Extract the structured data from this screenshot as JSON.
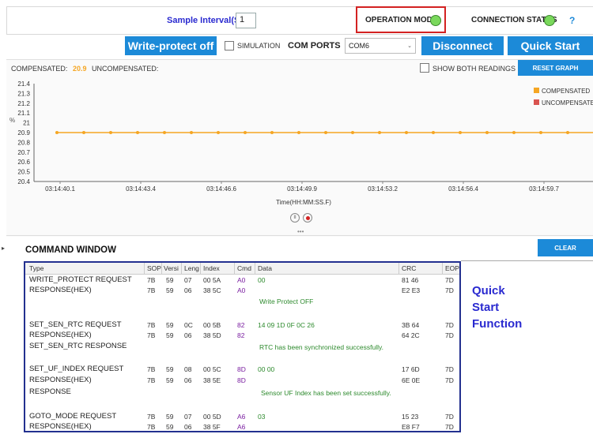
{
  "header": {
    "sample_interval_label": "Sample Interval(S)",
    "sample_interval_value": "1",
    "operation_mode_label": "OPERATION MODE",
    "connection_status_label": "CONNECTION STATUS",
    "help_label": "?"
  },
  "toolbar": {
    "write_protect_label": "Write-protect off",
    "simulation_label": "SIMULATION",
    "com_ports_label": "COM PORTS",
    "com_port_value": "COM6",
    "disconnect_label": "Disconnect",
    "quick_start_label": "Quick Start"
  },
  "readings": {
    "compensated_label": "COMPENSATED:",
    "compensated_value": "20.9",
    "uncompensated_label": "UNCOMPENSATED:",
    "show_both_label": "SHOW BOTH READINGS",
    "reset_graph_label": "RESET GRAPH"
  },
  "chart_data": {
    "type": "line",
    "ylabel": "%",
    "xlabel": "Time(HH:MM:SS.F)",
    "ylim": [
      20.4,
      21.4
    ],
    "yticks": [
      "21.4",
      "21.3",
      "21.2",
      "21.1",
      "21",
      "20.9",
      "20.8",
      "20.7",
      "20.6",
      "20.5",
      "20.4"
    ],
    "xticks": [
      "03:14:40.1",
      "03:14:43.4",
      "03:14:46.6",
      "03:14:49.9",
      "03:14:53.2",
      "03:14:56.4",
      "03:14:59.7"
    ],
    "legend": [
      "COMPENSATED",
      "UNCOMPENSATED"
    ],
    "series": [
      {
        "name": "COMPENSATED",
        "color": "#f5a623",
        "values": [
          20.9,
          20.9,
          20.9,
          20.9,
          20.9,
          20.9,
          20.9,
          20.9,
          20.9,
          20.9,
          20.9,
          20.9,
          20.9,
          20.9,
          20.9,
          20.9,
          20.9,
          20.9,
          20.9,
          20.9,
          20.9,
          20.9
        ]
      }
    ],
    "uncompensated_color": "#d9534f"
  },
  "command_window": {
    "title": "COMMAND WINDOW",
    "clear_label": "CLEAR",
    "columns": [
      "Type",
      "SOP",
      "Versi",
      "Leng",
      "Index",
      "Cmd",
      "Data",
      "CRC",
      "EOP"
    ],
    "rows": [
      {
        "type": "WRITE_PROTECT REQUEST",
        "sop": "7B",
        "ver": "59",
        "len": "07",
        "idx": "00 5A",
        "cmd": "A0",
        "data": "00",
        "crc": "81 46",
        "eop": "7D"
      },
      {
        "type": "RESPONSE(HEX)",
        "sop": "7B",
        "ver": "59",
        "len": "06",
        "idx": "38 5C",
        "cmd": "A0",
        "data": "",
        "crc": "E2 E3",
        "eop": "7D"
      },
      {
        "type": "",
        "msg": "Write Protect OFF"
      },
      {
        "type": "SET_SEN_RTC REQUEST",
        "sop": "7B",
        "ver": "59",
        "len": "0C",
        "idx": "00 5B",
        "cmd": "82",
        "data": "14 09 1D 0F 0C 26",
        "crc": "3B 64",
        "eop": "7D"
      },
      {
        "type": "RESPONSE(HEX)",
        "sop": "7B",
        "ver": "59",
        "len": "06",
        "idx": "38 5D",
        "cmd": "82",
        "data": "",
        "crc": "64 2C",
        "eop": "7D"
      },
      {
        "type": "SET_SEN_RTC RESPONSE",
        "msg": "RTC has been synchronized successfully."
      },
      {
        "type": "SET_UF_INDEX REQUEST",
        "sop": "7B",
        "ver": "59",
        "len": "08",
        "idx": "00 5C",
        "cmd": "8D",
        "data": "00 00",
        "crc": "17 6D",
        "eop": "7D"
      },
      {
        "type": "RESPONSE(HEX)",
        "sop": "7B",
        "ver": "59",
        "len": "06",
        "idx": "38 5E",
        "cmd": "8D",
        "data": "",
        "crc": "6E 0E",
        "eop": "7D"
      },
      {
        "type": "RESPONSE",
        "msg": "Sensor UF Index has been set successfully."
      },
      {
        "type": "GOTO_MODE REQUEST",
        "sop": "7B",
        "ver": "59",
        "len": "07",
        "idx": "00 5D",
        "cmd": "A6",
        "data": "03",
        "crc": "15 23",
        "eop": "7D"
      },
      {
        "type": "RESPONSE(HEX)",
        "sop": "7B",
        "ver": "59",
        "len": "06",
        "idx": "38 5F",
        "cmd": "A6",
        "data": "",
        "crc": "E8 F7",
        "eop": "7D"
      }
    ]
  },
  "annotation": {
    "line1": "Quick",
    "line2": "Start",
    "line3": "Function"
  }
}
